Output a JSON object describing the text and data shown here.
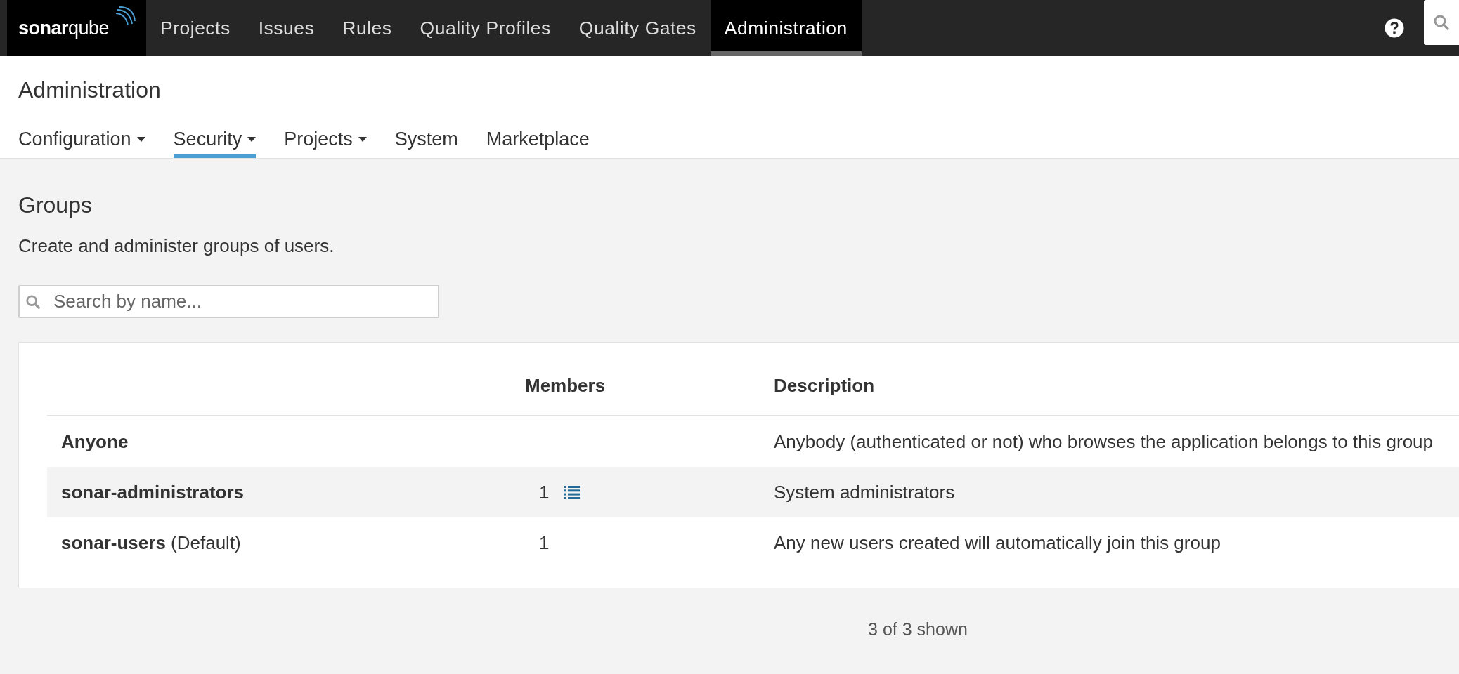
{
  "top_nav": {
    "logo": "**sonar**qube",
    "items": [
      {
        "label": "Projects",
        "selected": false
      },
      {
        "label": "Issues",
        "selected": false
      },
      {
        "label": "Rules",
        "selected": false
      },
      {
        "label": "Quality Profiles",
        "selected": false
      },
      {
        "label": "Quality Gates",
        "selected": false
      },
      {
        "label": "Administration",
        "selected": true
      }
    ]
  },
  "page": {
    "title": "Administration",
    "tabs": [
      {
        "label": "Configuration",
        "has_menu": true,
        "selected": false
      },
      {
        "label": "Security",
        "has_menu": true,
        "selected": true
      },
      {
        "label": "Projects",
        "has_menu": true,
        "selected": false
      },
      {
        "label": "System",
        "has_menu": false,
        "selected": false
      },
      {
        "label": "Marketplace",
        "has_menu": false,
        "selected": false
      }
    ]
  },
  "groups": {
    "title": "Groups",
    "description": "Create and administer groups of users.",
    "search": {
      "placeholder": "Search by name..."
    },
    "table": {
      "columns": [
        "Members",
        "Description"
      ],
      "rows": [
        {
          "name": "Anyone",
          "suffix": "",
          "members": "",
          "members_link": false,
          "description": "Anybody (authenticated or not) who browses the application belongs to this group",
          "hovered": false
        },
        {
          "name": "sonar-administrators",
          "suffix": "",
          "members": "1",
          "members_link": true,
          "description": "System administrators",
          "hovered": true
        },
        {
          "name": "sonar-users",
          "suffix": "(Default)",
          "members": "1",
          "members_link": false,
          "description": "Any new users created will automatically join this group",
          "hovered": false
        }
      ]
    },
    "footer": "3 of 3 shown"
  }
}
